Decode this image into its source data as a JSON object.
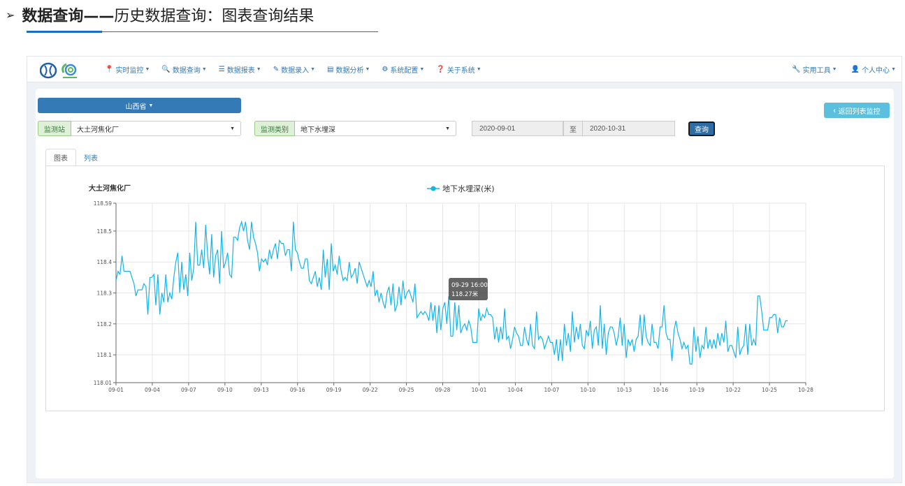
{
  "slide": {
    "arrow": "➢",
    "title_bold": "数据查询——",
    "title_rest": "历史数据查询：图表查询结果"
  },
  "nav": {
    "items": [
      {
        "icon": "📍",
        "icon_name": "map-marker-icon",
        "label": "实时监控"
      },
      {
        "icon": "🔍",
        "icon_name": "search-icon",
        "label": "数据查询"
      },
      {
        "icon": "☰",
        "icon_name": "list-icon",
        "label": "数据报表"
      },
      {
        "icon": "✎",
        "icon_name": "edit-icon",
        "label": "数据录入"
      },
      {
        "icon": "▤",
        "icon_name": "analysis-icon",
        "label": "数据分析"
      },
      {
        "icon": "⚙",
        "icon_name": "gear-icon",
        "label": "系统配置"
      },
      {
        "icon": "❓",
        "icon_name": "question-icon",
        "label": "关于系统"
      }
    ],
    "right": [
      {
        "icon": "🔧",
        "icon_name": "wrench-icon",
        "label": "实用工具"
      },
      {
        "icon": "👤",
        "icon_name": "user-icon",
        "label": "个人中心"
      }
    ]
  },
  "controls": {
    "province": "山西省",
    "back_label": "返回列表监控",
    "station_label": "监测站",
    "station_value": "大土河焦化厂",
    "category_label": "监测类别",
    "category_value": "地下水埋深",
    "date_from": "2020-09-01",
    "date_sep": "至",
    "date_to": "2020-10-31",
    "query_label": "查询"
  },
  "tabs": [
    {
      "label": "图表",
      "active": true
    },
    {
      "label": "列表",
      "active": false
    }
  ],
  "colors": {
    "primary": "#337ab7",
    "line": "#12b5ea",
    "info": "#5bc0de"
  },
  "chart_data": {
    "type": "line",
    "title": "大土河焦化厂",
    "legend": [
      "地下水埋深(米)"
    ],
    "legend_placement": "top-center",
    "ylim": [
      118.01,
      118.59
    ],
    "y_ticks": [
      "118.01",
      "118.1",
      "118.2",
      "118.3",
      "118.4",
      "118.5",
      "118.59"
    ],
    "x_ticks": [
      "09-01",
      "09-04",
      "09-07",
      "09-10",
      "09-13",
      "09-16",
      "09-19",
      "09-22",
      "09-25",
      "09-28",
      "10-01",
      "10-04",
      "10-07",
      "10-10",
      "10-13",
      "10-16",
      "10-19",
      "10-22",
      "10-25",
      "10-28"
    ],
    "grid": true,
    "tooltip": {
      "title": "09-29 16:00",
      "value": "118.27米"
    },
    "series": [
      {
        "name": "地下水埋深(米)",
        "values": [
          118.34,
          118.37,
          118.36,
          118.42,
          118.37,
          118.37,
          118.37,
          118.37,
          118.35,
          118.33,
          118.29,
          118.31,
          118.31,
          118.31,
          118.33,
          118.32,
          118.23,
          118.35,
          118.35,
          118.36,
          118.26,
          118.36,
          118.23,
          118.3,
          118.27,
          118.36,
          118.27,
          118.3,
          118.28,
          118.35,
          118.4,
          118.43,
          118.3,
          118.4,
          118.31,
          118.36,
          118.29,
          118.43,
          118.34,
          118.38,
          118.53,
          118.39,
          118.39,
          118.44,
          118.38,
          118.52,
          118.42,
          118.36,
          118.49,
          118.35,
          118.42,
          118.44,
          118.33,
          118.5,
          118.38,
          118.4,
          118.43,
          118.36,
          118.35,
          118.48,
          118.48,
          118.47,
          118.51,
          118.53,
          118.5,
          118.53,
          118.47,
          118.44,
          118.53,
          118.48,
          118.46,
          118.43,
          118.37,
          118.41,
          118.4,
          118.41,
          118.39,
          118.44,
          118.41,
          118.44,
          118.46,
          118.41,
          118.47,
          118.46,
          118.46,
          118.42,
          118.44,
          118.44,
          118.37,
          118.53,
          118.44,
          118.43,
          118.4,
          118.38,
          118.38,
          118.41,
          118.41,
          118.34,
          118.33,
          118.35,
          118.37,
          118.32,
          118.35,
          118.31,
          118.44,
          118.35,
          118.41,
          118.31,
          118.46,
          118.37,
          118.39,
          118.36,
          118.42,
          118.37,
          118.34,
          118.35,
          118.34,
          118.4,
          118.35,
          118.36,
          118.38,
          118.33,
          118.4,
          118.38,
          118.36,
          118.34,
          118.32,
          118.34,
          118.32,
          118.37,
          118.29,
          118.31,
          118.27,
          118.3,
          118.27,
          118.25,
          118.3,
          118.32,
          118.26,
          118.33,
          118.24,
          118.26,
          118.32,
          118.26,
          118.34,
          118.28,
          118.3,
          118.31,
          118.29,
          118.27,
          118.33,
          118.22,
          118.23,
          118.24,
          118.23,
          118.24,
          118.23,
          118.21,
          118.27,
          118.21,
          118.26,
          118.17,
          118.26,
          118.18,
          118.25,
          118.27,
          118.2,
          118.29,
          118.16,
          118.16,
          118.27,
          118.18,
          118.26,
          118.17,
          118.19,
          118.2,
          118.18,
          118.21,
          118.19,
          118.14,
          118.14,
          118.14,
          118.25,
          118.21,
          118.23,
          118.22,
          118.25,
          118.23,
          118.23,
          118.22,
          118.15,
          118.19,
          118.14,
          118.19,
          118.15,
          118.25,
          118.15,
          118.16,
          118.12,
          118.15,
          118.19,
          118.17,
          118.16,
          118.13,
          118.13,
          118.19,
          118.15,
          118.13,
          118.2,
          118.13,
          118.12,
          118.24,
          118.15,
          118.16,
          118.15,
          118.12,
          118.14,
          118.16,
          118.14,
          118.14,
          118.1,
          118.15,
          118.08,
          118.15,
          118.08,
          118.2,
          118.13,
          118.17,
          118.11,
          118.24,
          118.14,
          118.19,
          118.15,
          118.2,
          118.13,
          118.12,
          118.18,
          118.16,
          118.21,
          118.12,
          118.18,
          118.19,
          118.13,
          118.26,
          118.12,
          118.2,
          118.1,
          118.17,
          118.19,
          118.19,
          118.17,
          118.13,
          118.16,
          118.22,
          118.13,
          118.2,
          118.09,
          118.15,
          118.13,
          118.15,
          118.11,
          118.15,
          118.16,
          118.23,
          118.13,
          118.23,
          118.16,
          118.14,
          118.13,
          118.2,
          118.14,
          118.14,
          118.12,
          118.19,
          118.19,
          118.26,
          118.17,
          118.15,
          118.15,
          118.08,
          118.18,
          118.21,
          118.17,
          118.15,
          118.12,
          118.14,
          118.12,
          118.13,
          118.07,
          118.07,
          118.19,
          118.11,
          118.16,
          118.09,
          118.13,
          118.12,
          118.19,
          118.12,
          118.15,
          118.12,
          118.15,
          118.12,
          118.17,
          118.13,
          118.17,
          118.14,
          118.21,
          118.11,
          118.13,
          118.13,
          118.11,
          118.09,
          118.19,
          118.1,
          118.12,
          118.13,
          118.2,
          118.1,
          118.2,
          118.13,
          118.15,
          118.13,
          118.29,
          118.29,
          118.24,
          118.18,
          118.18,
          118.18,
          118.22,
          118.22,
          118.23,
          118.23,
          118.17,
          118.22,
          118.19,
          118.19,
          118.21,
          118.21
        ]
      }
    ]
  }
}
